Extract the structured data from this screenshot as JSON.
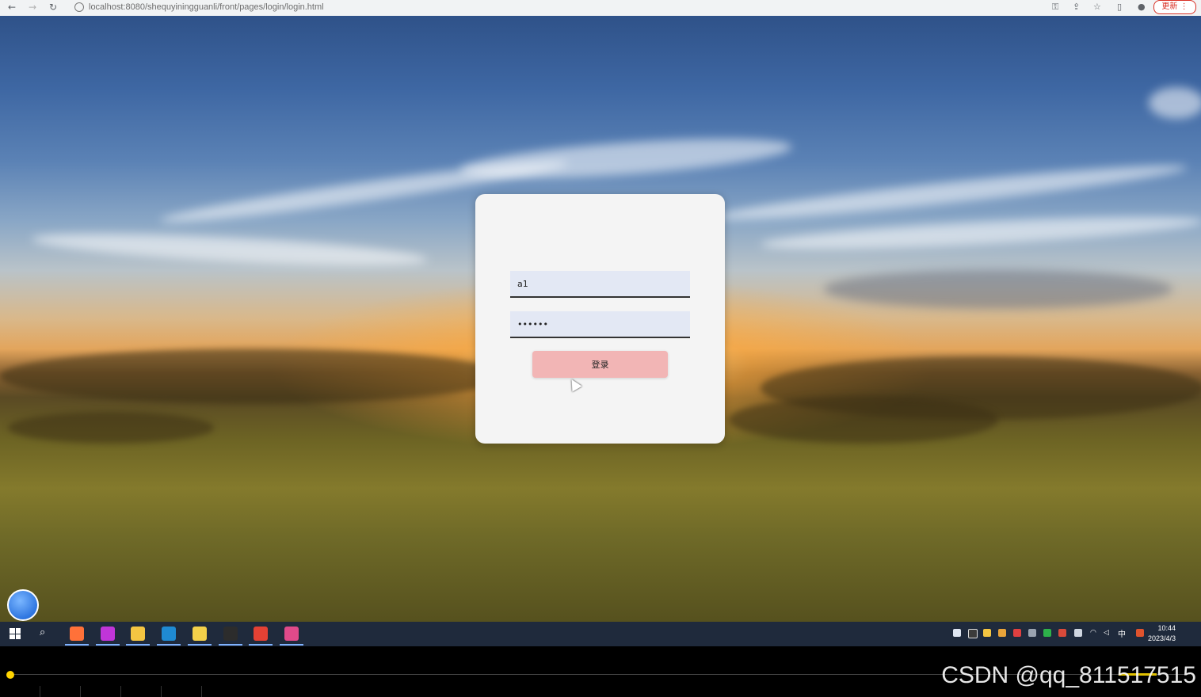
{
  "browser": {
    "back": "←",
    "forward": "→",
    "reload": "↻",
    "url": "localhost:8080/shequyiningguanli/front/pages/login/login.html",
    "update_label": "更新 ⋮"
  },
  "login": {
    "title": "",
    "username_value": "a1",
    "password_value": "••••••",
    "submit_label": "登录",
    "register_link": ""
  },
  "taskbar": {
    "apps": [
      {
        "icon": "firefox-icon",
        "color": "#ff7139"
      },
      {
        "icon": "app-icon",
        "color": "#c035d8"
      },
      {
        "icon": "file-explorer-icon",
        "color": "#f4c542"
      },
      {
        "icon": "vscode-icon",
        "color": "#1f8ad2"
      },
      {
        "icon": "folder-icon",
        "color": "#f3d04a"
      },
      {
        "icon": "terminal-icon",
        "color": "#2c2c2c"
      },
      {
        "icon": "chrome-icon",
        "color": "#e44134"
      },
      {
        "icon": "intellij-icon",
        "color": "#e04a8a"
      }
    ],
    "tray": {
      "ime": "中",
      "time": "10:44",
      "date": "2023/4/3"
    }
  },
  "player": {
    "watermark": "CSDN @qq_811517515"
  },
  "colors": {
    "card": "#f4f4f4",
    "button": "#f2b5b5",
    "input_bg": "#e3e8f4"
  }
}
